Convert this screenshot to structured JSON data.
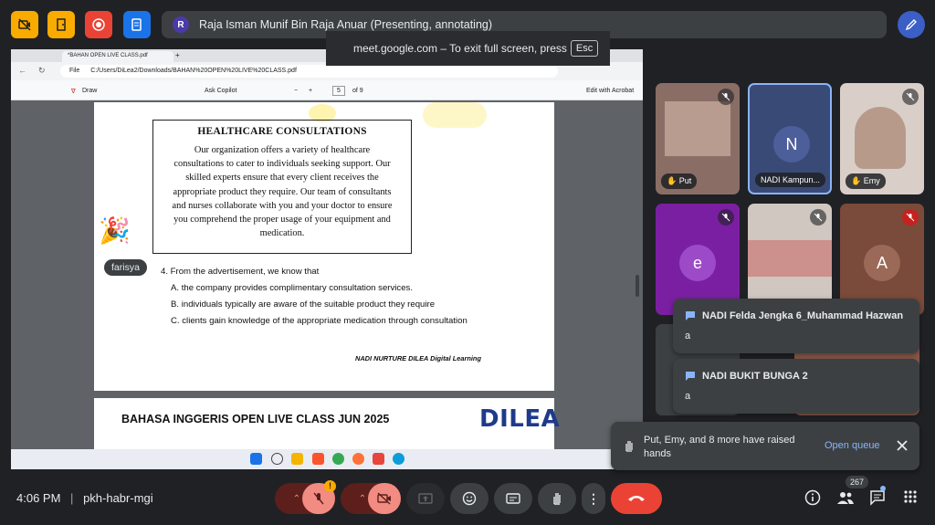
{
  "top": {
    "presenter_initial": "R",
    "presenter_label": "Raja Isman Munif Bin Raja Anuar (Presenting, annotating)"
  },
  "fullscreen_toast": {
    "text": "meet.google.com – To exit full screen, press",
    "key": "Esc"
  },
  "browser": {
    "tab_title": "*BAHAN OPEN LIVE CLASS.pdf",
    "file_label": "File",
    "url": "C:/Users/DiLea2/Downloads/BAHAN%20OPEN%20LIVE%20CLASS.pdf"
  },
  "pdf_toolbar": {
    "draw": "Draw",
    "ask_copilot": "Ask Copilot",
    "page_current": "5",
    "page_total": "of 9",
    "edit_acrobat": "Edit with Acrobat"
  },
  "document": {
    "box_title": "HEALTHCARE CONSULTATIONS",
    "box_lines": [
      "Our organization offers a variety of healthcare",
      "consultations to cater to individuals seeking support. Our",
      "skilled experts ensure that every client receives the",
      "appropriate product they require. Our team of consultants",
      "and nurses collaborate with you and your doctor to ensure",
      "you comprehend the proper usage of your equipment and",
      "medication."
    ],
    "question": "4.  From the advertisement, we know that",
    "options": [
      "A.  the company provides complimentary consultation services.",
      "B.  individuals typically are aware of the suitable product they require",
      "C.  clients gain knowledge of the appropriate medication through consultation"
    ],
    "footer": "NADI NURTURE DILEA Digital Learning",
    "next_page_title": "BAHASA INGGERIS OPEN LIVE CLASS JUN 2025",
    "next_page_logo": "DILEA"
  },
  "reaction_user": "farisya",
  "participants": [
    {
      "name": "Put",
      "kind": "video",
      "bg": "#8a6e66"
    },
    {
      "name": "NADI Kampun...",
      "initial": "N",
      "kind": "avatar",
      "bg": "#3a4a77",
      "circle": "#4d5f9a"
    },
    {
      "name": "Emy",
      "kind": "video",
      "bg": "#d9cfc8"
    },
    {
      "name": "",
      "initial": "e",
      "kind": "avatar",
      "bg": "#7b1fa2",
      "circle": "#9c4ac7"
    },
    {
      "name": "",
      "kind": "video",
      "bg": "#cfc7c0"
    },
    {
      "name": "",
      "initial": "A",
      "kind": "avatar",
      "bg": "#7a4a3a",
      "circle": "#9b6957"
    }
  ],
  "chats": [
    {
      "from": "NADI Felda Jengka 6_Muhammad Hazwan",
      "msg": "a"
    },
    {
      "from": "NADI BUKIT BUNGA 2",
      "msg": "a"
    }
  ],
  "raised_hands": {
    "text": "Put, Emy, and 8 more have raised hands",
    "action": "Open queue"
  },
  "bottom": {
    "time": "4:06 PM",
    "meeting_code": "pkh-habr-mgi",
    "participant_count": "267"
  },
  "colors": {
    "mic_off_bg": "#f28b82",
    "end_call": "#ea4335",
    "accent_blue": "#8ab4f8"
  }
}
